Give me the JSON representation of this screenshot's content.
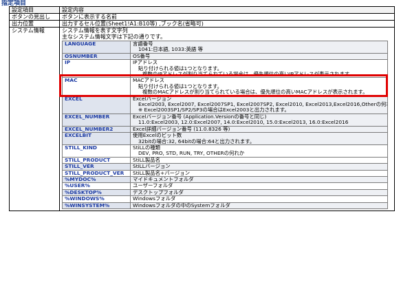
{
  "title": "指定項目",
  "header": {
    "col1": "設定項目",
    "col2": "設定内容"
  },
  "rows": [
    {
      "name": "ボタンの見出し",
      "desc": "ボタンに表示する名前"
    },
    {
      "name": "出力位置",
      "desc": "出力するセル位置(Sheet1!A1:B10等) ,ブック名(省略可)"
    },
    {
      "name": "システム情報",
      "desc1": "システム情報を表す文字列",
      "desc2": "主なシステム情報文字は下記の通りです。"
    }
  ],
  "system_info": [
    {
      "key": "LANGUAGE",
      "lines": [
        "言語番号",
        "1041:日本語, 1033:英語 等"
      ]
    },
    {
      "key": "OSNUMBER",
      "lines": [
        "OS番号"
      ]
    },
    {
      "key": "IP",
      "lines": [
        "IPアドレス",
        "貼り付けられる値は1つとなります。",
        "複数のIPアドレスが割り当てられている場合は、優先順位の高いIPアドレスが表示されます。"
      ]
    },
    {
      "key": "MAC",
      "lines": [
        "MACアドレス",
        "貼り付けられる値は1つとなります。",
        "複数のMACアドレスが割り当てられている場合は、優先順位の高いMACアドレスが表示されます。"
      ]
    },
    {
      "key": "EXCEL",
      "lines": [
        "Excelバージョン",
        "Excel2003, Excel2007, Excel2007SP1, Excel2007SP2, Excel2010, Excel2013,Excel2016,Otherの何れか",
        "※ Excel2003SP1/SP2/SP3の場合はExcel2003と出力されます。"
      ]
    },
    {
      "key": "EXCEL_NUMBER",
      "lines": [
        "Excelバージョン番号 (Application.Versionの番号と同じ)",
        "11.0:Excel2003, 12.0:Excel2007, 14.0:Excel2010, 15.0:Excel2013, 16.0:Excel2016"
      ]
    },
    {
      "key": "EXCEL_NUMBER2",
      "lines": [
        "Excel詳細バージョン番号 (11.0.8326 等)"
      ]
    },
    {
      "key": "EXCELBIT",
      "lines": [
        "使用Excelのビット数",
        "32bitの場合:32, 64bitの場合:64と出力されます。"
      ]
    },
    {
      "key": "STILL_KIND",
      "lines": [
        "StiLLの種類",
        "DEV, PRO, STD, RUN, TRY, OTHERの何れか"
      ]
    },
    {
      "key": "STILL_PRODUCT",
      "lines": [
        "StiLL製品名"
      ]
    },
    {
      "key": "STILL_VER",
      "lines": [
        "StiLLバージョン"
      ]
    },
    {
      "key": "STILL_PRODUCT_VER",
      "lines": [
        "StiLL製品名+バージョン"
      ]
    },
    {
      "key": "%MYDOC%",
      "lines": [
        "マイドキュメントフォルダ"
      ]
    },
    {
      "key": "%USER%",
      "lines": [
        "ユーザーフォルダ"
      ]
    },
    {
      "key": "%DESKTOP%",
      "lines": [
        "デスクトップフォルダ"
      ]
    },
    {
      "key": "%WINDOWS%",
      "lines": [
        "Windowsフォルダ"
      ]
    },
    {
      "key": "%WINSYSTEM%",
      "lines": [
        "Windowsフォルダの中のSystemフォルダ"
      ]
    }
  ],
  "highlight_color": "#e00000"
}
